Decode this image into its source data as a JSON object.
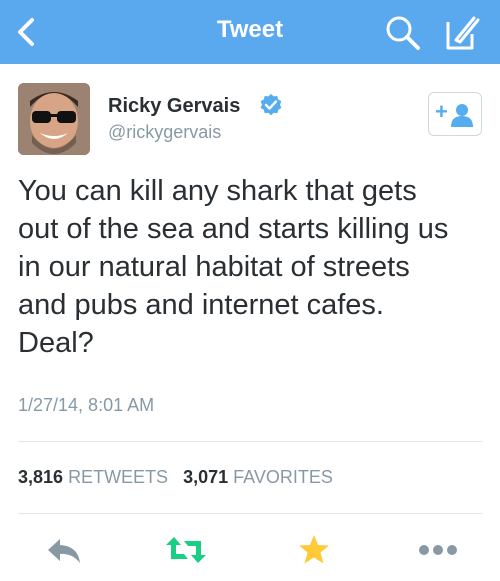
{
  "colors": {
    "navbar": "#5aa8ee",
    "link_blue": "#55acee",
    "retweet_green": "#19cf86",
    "favorite_gold": "#ffc937",
    "muted_gray": "#8899a6",
    "text": "#292f33"
  },
  "navbar": {
    "title": "Tweet",
    "icons": [
      "back-chevron-icon",
      "search-icon",
      "compose-icon"
    ]
  },
  "user": {
    "name": "Ricky Gervais",
    "handle": "@rickygervais",
    "verified": true,
    "follow_button": {
      "plus": "+",
      "icon": "follow-person-icon"
    }
  },
  "tweet": {
    "lines": [
      "You can kill any shark that gets",
      "out of the sea and starts killing us",
      "in our natural habitat of streets",
      "and pubs and internet cafes.",
      "Deal?"
    ],
    "timestamp": "1/27/14, 8:01 AM"
  },
  "stats": {
    "retweets_count": "3,816",
    "retweets_label": "RETWEETS",
    "favorites_count": "3,071",
    "favorites_label": "FAVORITES"
  },
  "actions": [
    "reply-icon",
    "retweet-icon",
    "favorite-star-icon",
    "more-dots-icon"
  ]
}
